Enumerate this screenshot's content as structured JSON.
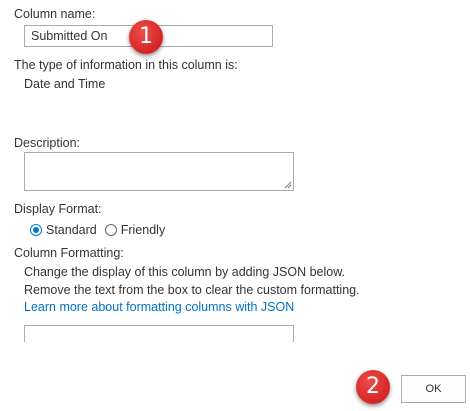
{
  "column_name": {
    "label": "Column name:",
    "value": "Submitted On"
  },
  "type_info": {
    "label": "The type of information in this column is:",
    "value": "Date and Time"
  },
  "description": {
    "label": "Description:",
    "value": ""
  },
  "display_format": {
    "label": "Display Format:",
    "options": [
      "Standard",
      "Friendly"
    ],
    "selected": "Standard"
  },
  "column_formatting": {
    "label": "Column Formatting:",
    "help_line1": "Change the display of this column by adding JSON below.",
    "help_line2": "Remove the text from the box to clear the custom formatting.",
    "link_text": "Learn more about formatting columns with JSON"
  },
  "ok_button": {
    "label": "OK"
  },
  "annotations": {
    "badge1": "1",
    "badge2": "2",
    "badge_color": "#d42525"
  },
  "colors": {
    "link": "#0072c6",
    "accent": "#0078d4",
    "border": "#ababab"
  }
}
